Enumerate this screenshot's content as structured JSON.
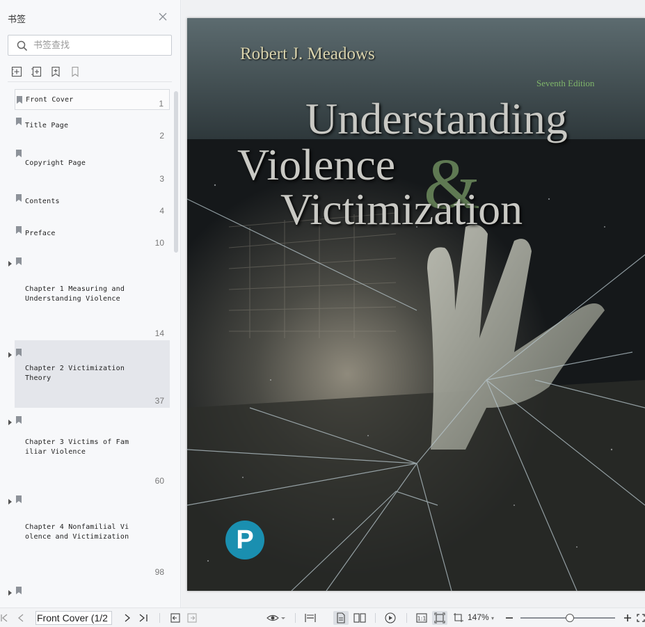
{
  "sidebar": {
    "title": "书签",
    "search_placeholder": "书签查找",
    "tools": [
      "add-bookmark-icon",
      "add-child-bookmark-icon",
      "bookmark-star-icon",
      "bookmark-outline-icon"
    ],
    "items": [
      {
        "label": "Front Cover",
        "page": "1",
        "expandable": false
      },
      {
        "label": "Title Page",
        "page": "2",
        "expandable": false
      },
      {
        "label": "Copyright Page",
        "page": "3",
        "expandable": false
      },
      {
        "label": "Contents",
        "page": "4",
        "expandable": false
      },
      {
        "label": "Preface",
        "page": "10",
        "expandable": false
      },
      {
        "label": "Chapter 1 Measuring and\nUnderstanding Violence",
        "page": "14",
        "expandable": true
      },
      {
        "label": "Chapter 2 Victimization\nTheory",
        "page": "37",
        "expandable": true
      },
      {
        "label": "Chapter 3 Victims of Fam\niliar Violence",
        "page": "60",
        "expandable": true
      },
      {
        "label": "Chapter 4 Nonfamilial Vi\nolence and Victimization",
        "page": "98",
        "expandable": true
      },
      {
        "label": "",
        "page": "",
        "expandable": true
      }
    ]
  },
  "cover": {
    "author": "Robert J. Meadows",
    "edition": "Seventh Edition",
    "title_line1": "Understanding",
    "title_line2": "Violence",
    "title_ampersand": "&",
    "title_line3": "Victimization",
    "publisher_logo_letter": "P"
  },
  "toolbar": {
    "page_field_value": "Front Cover (1/2",
    "zoom_level": "147%",
    "zoom_fraction": 0.52
  },
  "colors": {
    "accent_green": "#6fa35c",
    "logo_blue": "#1a8fb0"
  }
}
